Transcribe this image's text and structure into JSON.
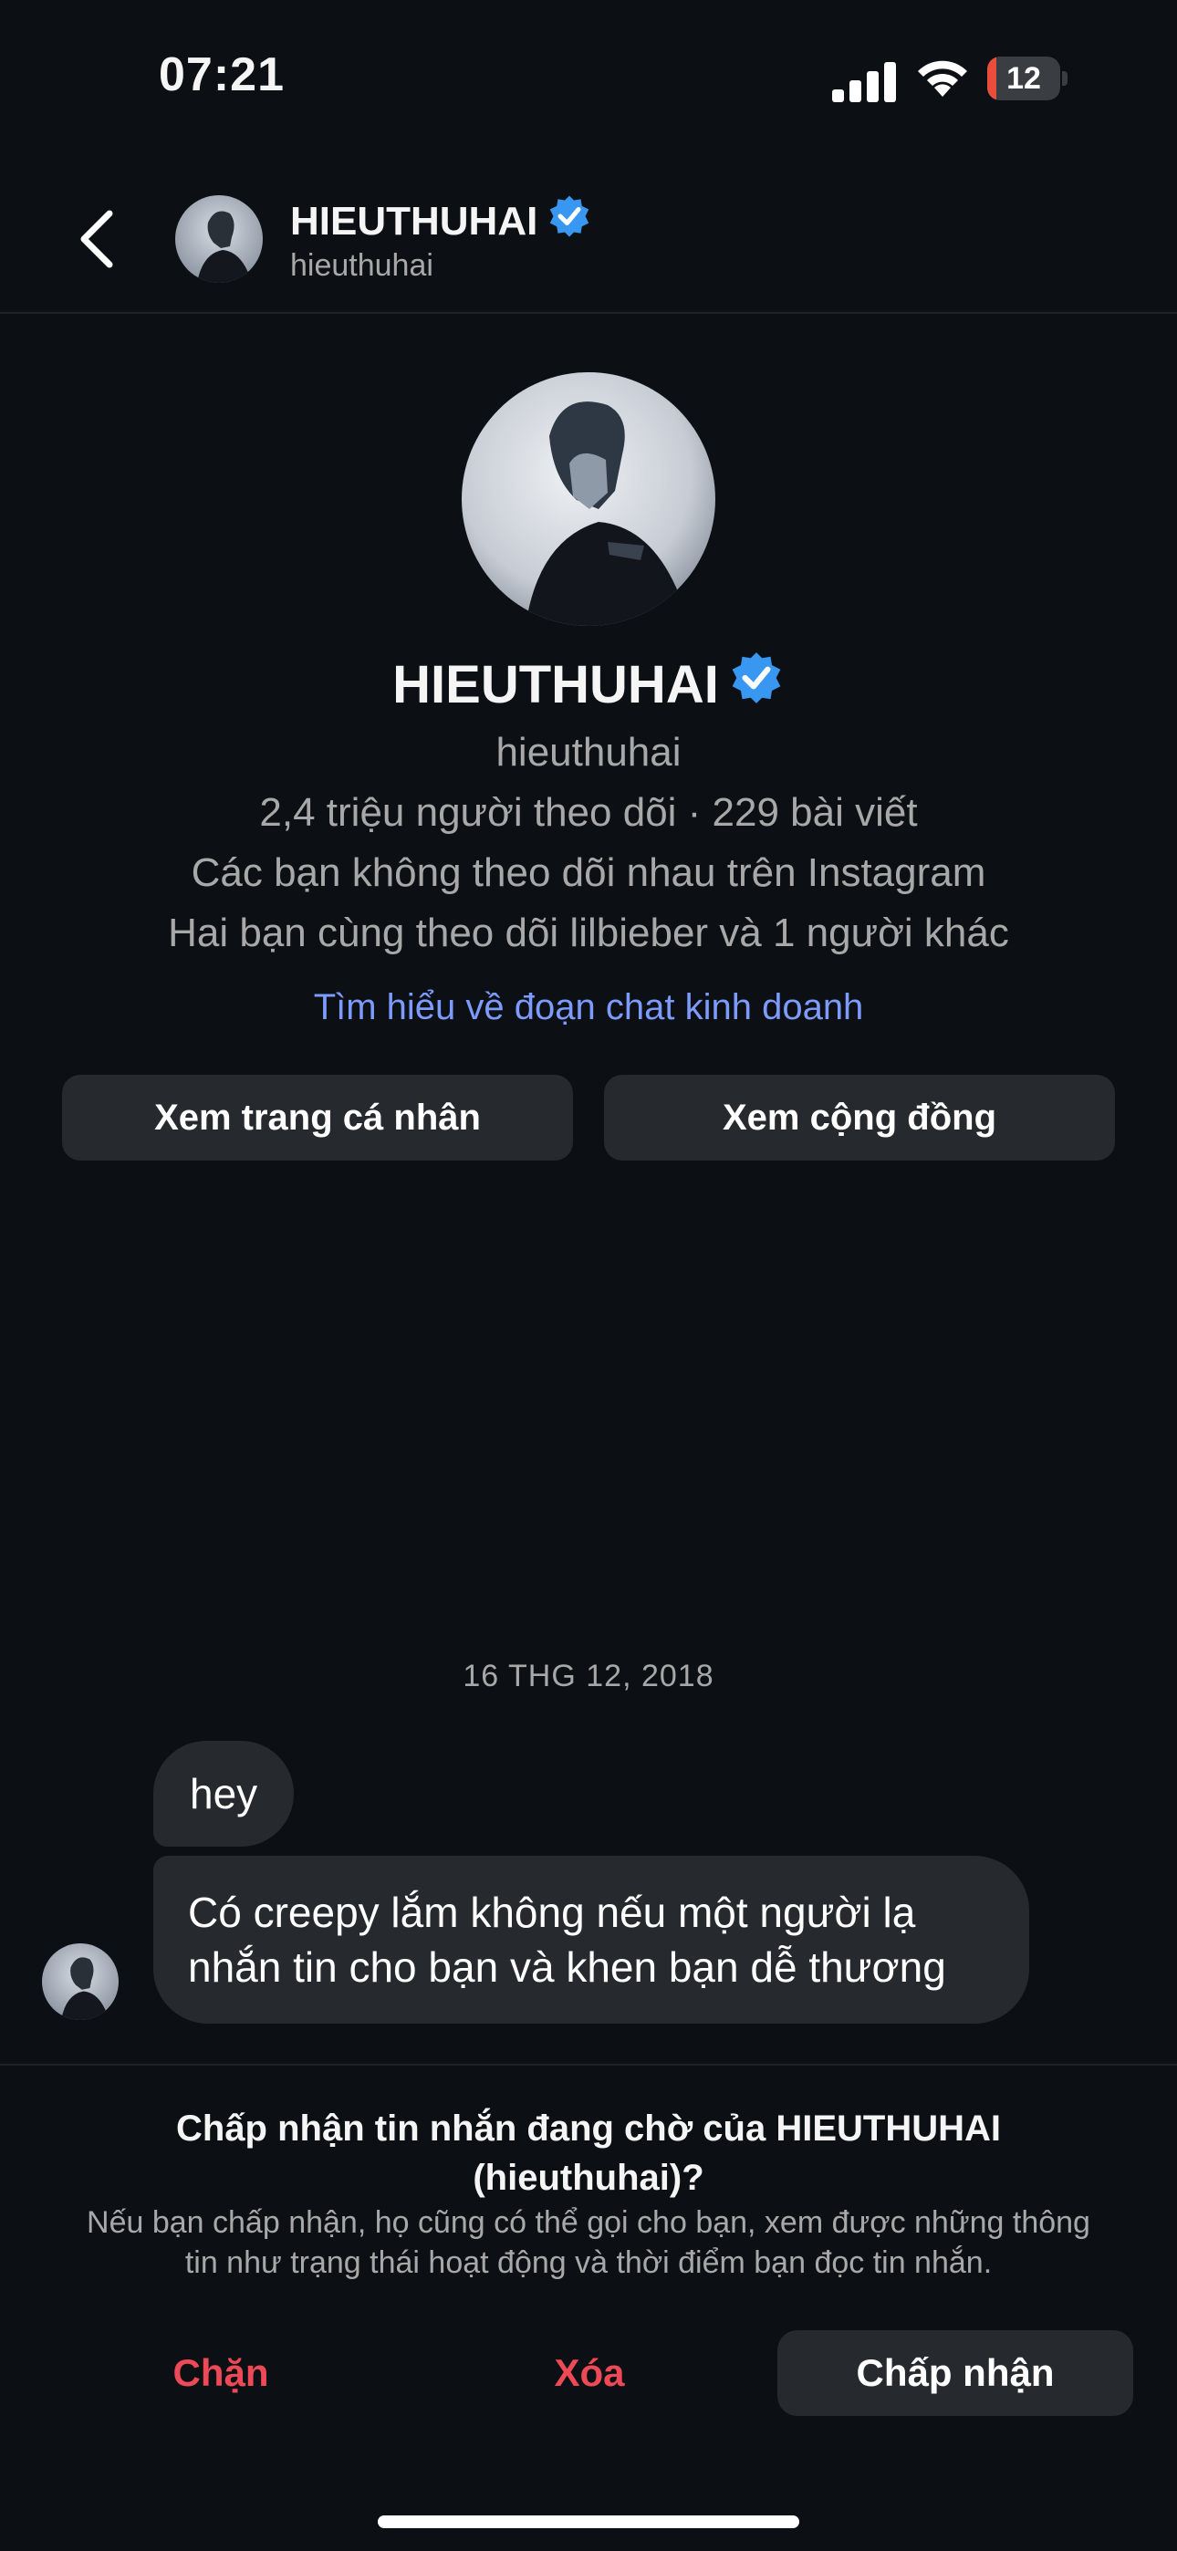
{
  "status_bar": {
    "time": "07:21",
    "battery_level": "12",
    "battery_fraction": 0.12,
    "icons": [
      "signal-icon",
      "wifi-icon",
      "battery-icon"
    ]
  },
  "header": {
    "name": "HIEUTHUHAI",
    "handle": "hieuthuhai",
    "back_icon": "chevron-left-icon",
    "verified_icon": "verified-badge-icon"
  },
  "profile": {
    "name": "HIEUTHUHAI",
    "handle": "hieuthuhai",
    "stats": "2,4 triệu người theo dõi · 229 bài viết",
    "follow_status": "Các bạn không theo dõi nhau trên Instagram",
    "mutual": "Hai bạn cùng theo dõi lilbieber và 1 người khác",
    "business_link": "Tìm hiểu về đoạn chat kinh doanh",
    "view_profile_button": "Xem trang cá nhân",
    "view_community_button": "Xem cộng đồng"
  },
  "messages": {
    "date": "16 THG 12, 2018",
    "items": [
      {
        "text": "hey"
      },
      {
        "text": "Có creepy lắm không nếu một người lạ nhắn tin cho bạn và khen bạn dễ thương"
      }
    ]
  },
  "request": {
    "title": "Chấp nhận tin nhắn đang chờ của HIEUTHUHAI (hieuthuhai)?",
    "description": "Nếu bạn chấp nhận, họ cũng có thể gọi cho bạn, xem được những thông tin như trạng thái hoạt động và thời điểm bạn đọc tin nhắn.",
    "block_label": "Chặn",
    "delete_label": "Xóa",
    "accept_label": "Chấp nhận"
  },
  "colors": {
    "background": "#0c1014",
    "bubble": "#26292e",
    "link": "#7d9bfc",
    "danger": "#ed4956",
    "verified": "#3897f0",
    "battery_low": "#eb4d3d"
  }
}
